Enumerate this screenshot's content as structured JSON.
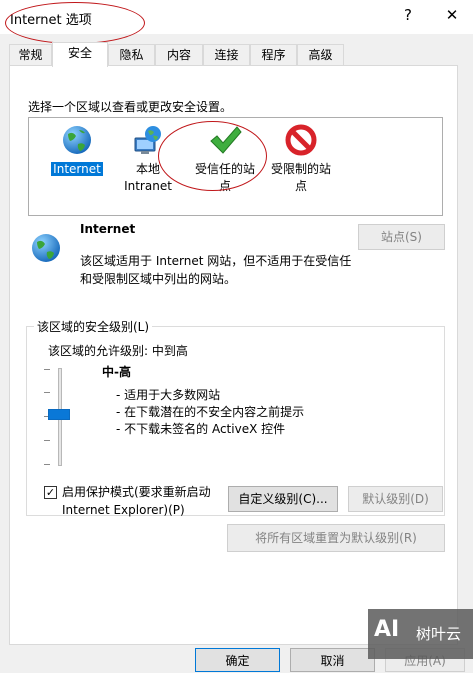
{
  "window": {
    "title": "Internet 选项",
    "help_glyph": "?",
    "close_glyph": "✕"
  },
  "tabs": [
    {
      "label": "常规"
    },
    {
      "label": "安全"
    },
    {
      "label": "隐私"
    },
    {
      "label": "内容"
    },
    {
      "label": "连接"
    },
    {
      "label": "程序"
    },
    {
      "label": "高级"
    }
  ],
  "active_tab": "安全",
  "security": {
    "instruction": "选择一个区域以查看或更改安全设置。",
    "zones": [
      {
        "line1": "Internet",
        "line2": "",
        "icon": "globe-icon",
        "selected": true
      },
      {
        "line1": "本地",
        "line2": "Intranet",
        "icon": "intranet-icon",
        "selected": false
      },
      {
        "line1": "受信任的站",
        "line2": "点",
        "icon": "checkmark-icon",
        "selected": false
      },
      {
        "line1": "受限制的站",
        "line2": "点",
        "icon": "restricted-icon",
        "selected": false
      }
    ],
    "zone_info": {
      "name": "Internet",
      "desc_line1": "该区域适用于 Internet 网站，但不适用于在受信任",
      "desc_line2": "和受限制区域中列出的网站。",
      "sites_button": "站点(S)"
    },
    "level_group": {
      "legend": "该区域的安全级别(L)",
      "allowed_level": "该区域的允许级别: 中到高",
      "level_name": "中-高",
      "bullets": [
        "- 适用于大多数网站",
        "- 在下载潜在的不安全内容之前提示",
        "- 不下载未签名的 ActiveX 控件"
      ],
      "protected_mode_line1": "启用保护模式(要求重新启动",
      "protected_mode_line2": "Internet Explorer)(P)",
      "protected_mode_checked": true,
      "custom_button": "自定义级别(C)...",
      "default_button": "默认级别(D)",
      "reset_all_button": "将所有区域重置为默认级别(R)"
    }
  },
  "footer": {
    "ok_button": "确定",
    "cancel_button": "取消",
    "apply_button": "应用(A)"
  },
  "watermark": {
    "logo_text": "AI",
    "brand": "树叶云"
  },
  "colors": {
    "selection": "#0078d7",
    "annotation": "#c0171a",
    "slider_thumb": "#0a78d7"
  }
}
